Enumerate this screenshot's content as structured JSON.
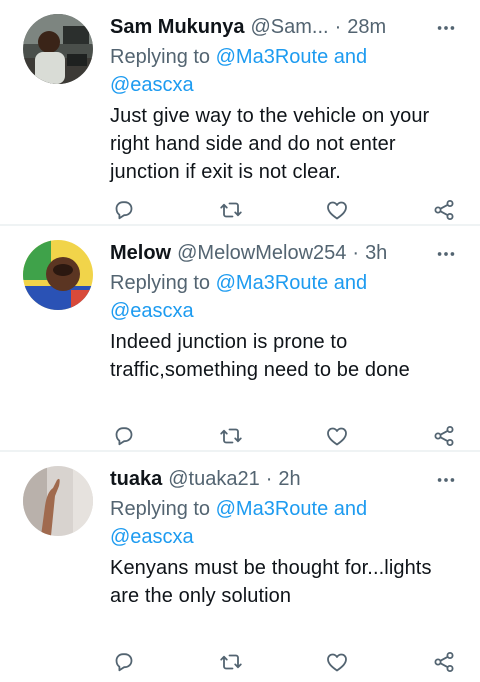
{
  "tweets": [
    {
      "name": "Sam Mukunya",
      "handle": "@Sam...",
      "separator": "·",
      "time": "28m",
      "replying_prefix": "Replying to",
      "replying_users": "@Ma3Route and",
      "replying_second": "@eascxa",
      "text": "Just give way to the vehicle on your right hand side and do not enter junction if exit is not clear.",
      "avatar_icon": "avatar-photo-man-at-desk"
    },
    {
      "name": "Melow",
      "handle": "@MelowMelow254",
      "separator": "·",
      "time": "3h",
      "replying_prefix": "Replying to",
      "replying_users": "@Ma3Route and",
      "replying_second": "@eascxa",
      "text": "Indeed junction is prone to traffic,something need to be done",
      "avatar_icon": "avatar-photo-baby"
    },
    {
      "name": "tuaka",
      "handle": "@tuaka21",
      "separator": "·",
      "time": "2h",
      "replying_prefix": "Replying to",
      "replying_users": "@Ma3Route and",
      "replying_second": "@eascxa",
      "text": "Kenyans must be thought for...lights are the only solution",
      "avatar_icon": "avatar-photo-hand-on-wall"
    }
  ],
  "icons": {
    "more": "more-icon",
    "reply": "reply-icon",
    "retweet": "retweet-icon",
    "like": "like-icon",
    "share": "share-icon"
  },
  "colors": {
    "text": "#0f1419",
    "secondary": "#536471",
    "mention": "#1d9bf0",
    "divider": "#eff3f4"
  }
}
